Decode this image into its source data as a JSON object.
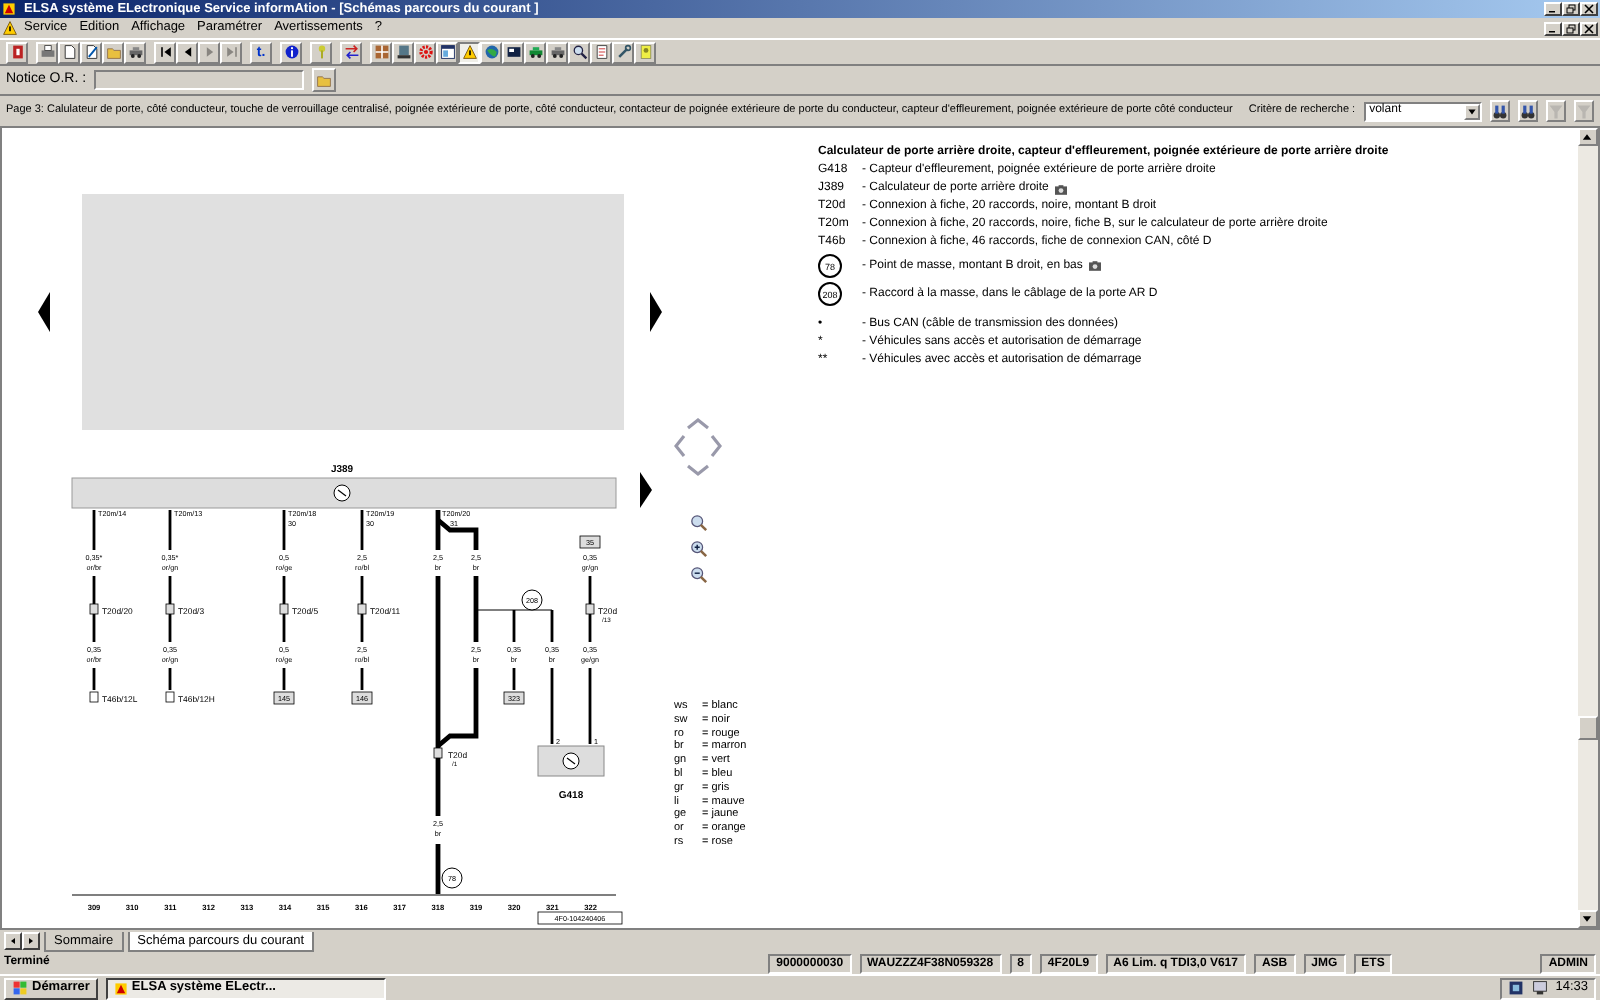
{
  "window": {
    "title": "ELSA système ELectronique Service informAtion - [Schémas parcours du courant ]"
  },
  "menu": [
    "Service",
    "Edition",
    "Affichage",
    "Paramétrer",
    "Avertissements",
    "?"
  ],
  "toolbar": [
    {
      "disabled": false,
      "pressed": false
    },
    {
      "disabled": false,
      "pressed": false
    },
    {
      "disabled": false,
      "pressed": false
    },
    {
      "disabled": false,
      "pressed": false
    },
    {
      "disabled": false,
      "pressed": false
    },
    {
      "disabled": false,
      "pressed": false
    },
    {
      "disabled": false,
      "pressed": false
    },
    {
      "disabled": false,
      "pressed": false
    },
    {
      "disabled": true,
      "pressed": false
    },
    {
      "disabled": true,
      "pressed": false
    },
    {
      "disabled": false,
      "pressed": false,
      "glyph": "t."
    },
    {
      "disabled": false,
      "pressed": false
    },
    {
      "disabled": false,
      "pressed": false
    },
    {
      "disabled": false,
      "pressed": false
    },
    {
      "disabled": false,
      "pressed": false
    },
    {
      "disabled": false,
      "pressed": false
    },
    {
      "disabled": false,
      "pressed": false
    },
    {
      "disabled": false,
      "pressed": false
    },
    {
      "disabled": false,
      "pressed": true
    },
    {
      "disabled": false,
      "pressed": false
    },
    {
      "disabled": false,
      "pressed": false
    },
    {
      "disabled": false,
      "pressed": false
    },
    {
      "disabled": false,
      "pressed": false
    },
    {
      "disabled": false,
      "pressed": false
    },
    {
      "disabled": false,
      "pressed": false
    },
    {
      "disabled": false,
      "pressed": false
    },
    {
      "disabled": false,
      "pressed": false
    }
  ],
  "notice": {
    "label": "Notice O.R. :"
  },
  "page_bar": {
    "text": "Page 3: Calulateur de porte, côté conducteur, touche de verrouillage centralisé, poignée extérieure de porte, côté conducteur, contacteur de poignée extérieure de porte du conducteur, capteur d'effleurement, poignée extérieure de porte côté conducteur",
    "search_label": "Critère de recherche :",
    "search_value": "volant",
    "buttons": [
      {
        "disabled": false
      },
      {
        "disabled": false
      },
      {
        "disabled": true
      },
      {
        "disabled": true
      }
    ]
  },
  "legend": {
    "title": "Calculateur de porte arrière droite, capteur d'effleurement, poignée extérieure de porte arrière droite",
    "items": [
      {
        "kind": "code",
        "code": "G418",
        "text": "- Capteur d'effleurement, poignée extérieure de porte arrière droite",
        "photo": false
      },
      {
        "kind": "code",
        "code": "J389",
        "text": "- Calculateur de porte arrière droite",
        "photo": true
      },
      {
        "kind": "code",
        "code": "T20d",
        "text": "- Connexion à fiche, 20 raccords, noire, montant B droit",
        "photo": false
      },
      {
        "kind": "code",
        "code": "T20m",
        "text": "- Connexion à fiche, 20 raccords, noire, fiche B, sur le calculateur de porte arrière droite",
        "photo": false
      },
      {
        "kind": "code",
        "code": "T46b",
        "text": "- Connexion à fiche, 46 raccords, fiche de connexion CAN, côté D",
        "photo": false
      },
      {
        "kind": "ground",
        "code": "78",
        "text": "- Point de masse, montant B droit, en bas",
        "photo": true
      },
      {
        "kind": "ground",
        "code": "208",
        "text": "- Raccord à la masse, dans le câblage de la porte AR D",
        "photo": false
      },
      {
        "kind": "mark",
        "code": "•",
        "text": "- Bus CAN (câble de transmission des données)",
        "photo": false
      },
      {
        "kind": "mark",
        "code": "*",
        "text": "- Véhicules sans accès et autorisation de démarrage",
        "photo": false
      },
      {
        "kind": "mark",
        "code": "**",
        "text": "- Véhicules avec accès et autorisation de démarrage",
        "photo": false
      }
    ]
  },
  "colors": [
    {
      "code": "ws",
      "meaning": "= blanc"
    },
    {
      "code": "sw",
      "meaning": "= noir"
    },
    {
      "code": "ro",
      "meaning": "= rouge"
    },
    {
      "code": "br",
      "meaning": "= marron"
    },
    {
      "code": "gn",
      "meaning": "= vert"
    },
    {
      "code": "bl",
      "meaning": "= bleu"
    },
    {
      "code": "gr",
      "meaning": "= gris"
    },
    {
      "code": "li",
      "meaning": "= mauve"
    },
    {
      "code": "ge",
      "meaning": "= jaune"
    },
    {
      "code": "or",
      "meaning": "= orange"
    },
    {
      "code": "rs",
      "meaning": "= rose"
    }
  ],
  "diagram": {
    "component": "J389",
    "sensor": "G418",
    "wires": [
      {
        "pin": "T20m/14",
        "upper": [
          "0,35*",
          "or/br"
        ],
        "connector": "T20d/20",
        "lower": [
          "0,35",
          "or/br"
        ],
        "end": "T46b/12L",
        "kind": "plug"
      },
      {
        "pin": "T20m/13",
        "upper": [
          "0,35*",
          "or/gn"
        ],
        "connector": "T20d/3",
        "lower": [
          "0,35",
          "or/gn"
        ],
        "end": "T46b/12H",
        "kind": "plug"
      },
      {
        "pin": "T20m/18",
        "terminal": "30",
        "upper": [
          "0,5",
          "ro/ge"
        ],
        "connector": "T20d/5",
        "lower": [
          "0,5",
          "ro/ge"
        ],
        "end": "145",
        "kind": "box"
      },
      {
        "pin": "T20m/19",
        "terminal": "30",
        "upper": [
          "2,5",
          "ro/bl"
        ],
        "connector": "T20d/11",
        "lower": [
          "2,5",
          "ro/bl"
        ],
        "end": "146",
        "kind": "box"
      }
    ],
    "ground_wire": {
      "pin": "T20m/20",
      "terminal": "31",
      "upper": [
        "2,5",
        "br"
      ],
      "connector": [
        "T20d",
        "/1"
      ],
      "lower": [
        "2,5",
        "br"
      ],
      "ground": "78"
    },
    "loop": {
      "upper": [
        "2,5",
        "br"
      ],
      "lower": [
        "2,5",
        "br"
      ]
    },
    "splice": "208",
    "branch_a": {
      "label": [
        "0,35",
        "br"
      ],
      "end": "323"
    },
    "branch_b": {
      "label": [
        "0,35",
        "br"
      ],
      "pin": "2"
    },
    "sensor_wire": {
      "start": "35",
      "upper": [
        "0,35",
        "gr/gn"
      ],
      "connector": [
        "T20d",
        "/13"
      ],
      "lower": [
        "0,35",
        "ge/gn"
      ],
      "pin": "1"
    },
    "columns": [
      "309",
      "310",
      "311",
      "312",
      "313",
      "314",
      "315",
      "316",
      "317",
      "318",
      "319",
      "320",
      "321",
      "322"
    ],
    "reference": "4F0-104240406"
  },
  "tabs": [
    {
      "label": "Sommaire",
      "selected": false
    },
    {
      "label": "Schéma parcours du courant",
      "selected": true
    }
  ],
  "status": {
    "message": "Terminé",
    "panels": [
      "9000000030",
      "WAUZZZ4F38N059328",
      "8",
      "4F20L9",
      "A6 Lim. q TDI3,0 V617",
      "ASB",
      "JMG",
      "ETS",
      "ADMIN"
    ]
  },
  "taskbar": {
    "start": "Démarrer",
    "tasks": [
      {
        "label": "ELSA système ELectr...",
        "selected": true
      }
    ],
    "clock": "14:33"
  }
}
